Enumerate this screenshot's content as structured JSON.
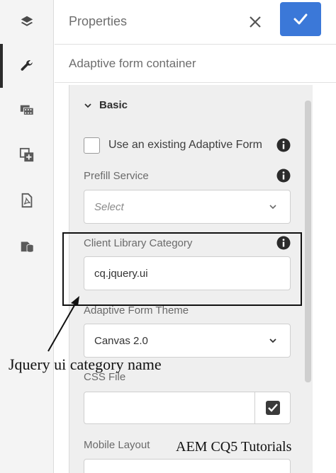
{
  "header": {
    "title": "Properties"
  },
  "subtitle": "Adaptive form container",
  "rail": {
    "items": [
      {
        "icon": "layers-icon"
      },
      {
        "icon": "wrench-icon"
      },
      {
        "icon": "film-icon"
      },
      {
        "icon": "add-page-icon"
      },
      {
        "icon": "pdf-icon"
      },
      {
        "icon": "database-icon"
      }
    ]
  },
  "section": {
    "label": "Basic"
  },
  "checkbox": {
    "label": "Use an existing Adaptive Form",
    "checked": false
  },
  "prefill": {
    "label": "Prefill Service",
    "placeholder": "Select"
  },
  "clientlib": {
    "label": "Client Library Category",
    "value": "cq.jquery.ui"
  },
  "theme": {
    "label": "Adaptive Form Theme",
    "value": "Canvas 2.0"
  },
  "css": {
    "label": "CSS File",
    "value": ""
  },
  "mobile": {
    "label": "Mobile Layout"
  },
  "annotations": {
    "jquery_caption": "Jquery ui category name",
    "aem_caption": "AEM CQ5 Tutorials"
  },
  "colors": {
    "primary": "#3b78d8",
    "rail_bg": "#f4f4f4",
    "panel_bg": "#efefef"
  }
}
